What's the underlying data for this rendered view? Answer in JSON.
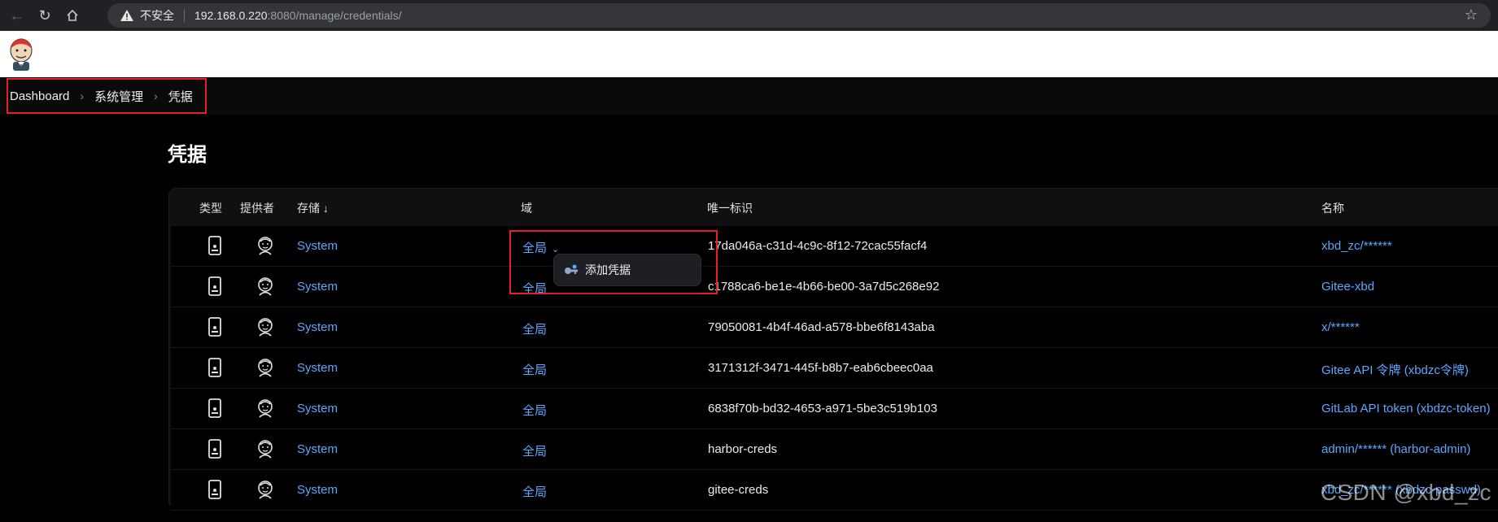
{
  "browser": {
    "insecure_label": "不安全",
    "url_host": "192.168.0.220",
    "url_rest": ":8080/manage/credentials/"
  },
  "breadcrumb": [
    "Dashboard",
    "系统管理",
    "凭据"
  ],
  "page_title": "凭据",
  "table": {
    "headers": {
      "type": "类型",
      "provider": "提供者",
      "store": "存储 ↓",
      "domain": "域",
      "id": "唯一标识",
      "name": "名称"
    },
    "rows": [
      {
        "store": "System",
        "domain": "全局",
        "id": "17da046a-c31d-4c9c-8f12-72cac55facf4",
        "name": "xbd_zc/******"
      },
      {
        "store": "System",
        "domain": "全局",
        "id": "c1788ca6-be1e-4b66-be00-3a7d5c268e92",
        "name": "Gitee-xbd"
      },
      {
        "store": "System",
        "domain": "全局",
        "id": "79050081-4b4f-46ad-a578-bbe6f8143aba",
        "name": "x/******"
      },
      {
        "store": "System",
        "domain": "全局",
        "id": "3171312f-3471-445f-b8b7-eab6cbeec0aa",
        "name": "Gitee API 令牌 (xbdzc令牌)"
      },
      {
        "store": "System",
        "domain": "全局",
        "id": "6838f70b-bd32-4653-a971-5be3c519b103",
        "name": "GitLab API token (xbdzc-token)"
      },
      {
        "store": "System",
        "domain": "全局",
        "id": "harbor-creds",
        "name": "admin/****** (harbor-admin)"
      },
      {
        "store": "System",
        "domain": "全局",
        "id": "gitee-creds",
        "name": "xbd_zc/****** (xbdzc-passwd)"
      }
    ]
  },
  "dropdown": {
    "item_label": "添加凭据"
  },
  "watermark": "CSDN @xbd_zc"
}
